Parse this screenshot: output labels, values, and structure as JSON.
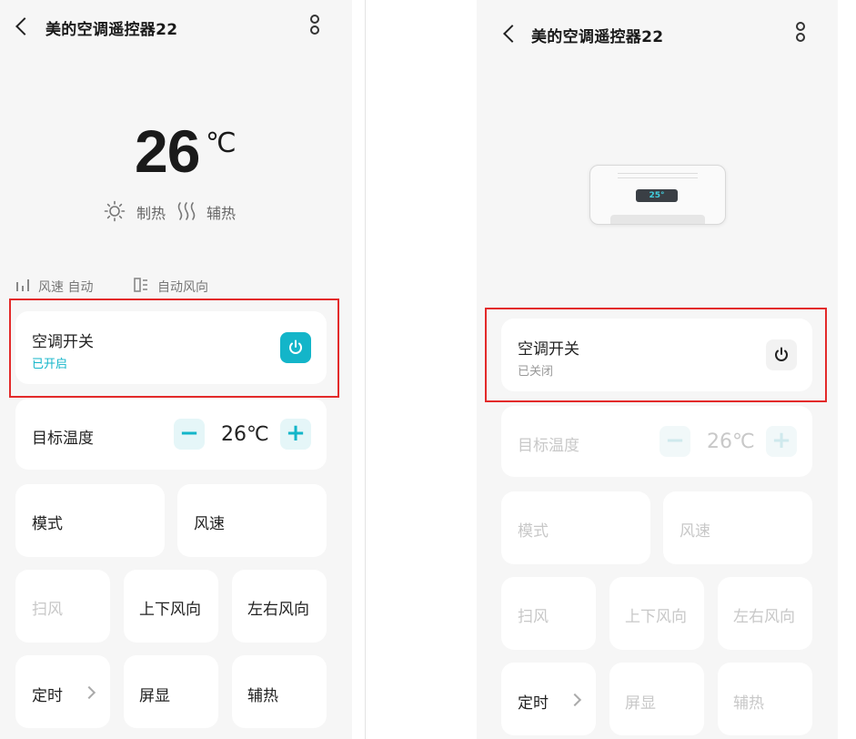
{
  "app_title": "美的空调遥控器22",
  "left": {
    "temperature": "26",
    "unit": "℃",
    "mode_label": "制热",
    "aux_heat_label": "辅热",
    "fan_speed_info": "风速 自动",
    "wind_direction_info": "自动风向",
    "power": {
      "label": "空调开关",
      "status": "已开启",
      "accent": "#13b5c9"
    },
    "target_temp": {
      "label": "目标温度",
      "minus": "−",
      "value": "26℃",
      "plus": "+"
    },
    "buttons": {
      "mode": "模式",
      "fan_speed": "风速",
      "swing": "扫风",
      "swing_vertical": "上下风向",
      "swing_horizontal": "左右风向",
      "timer": "定时",
      "display": "屏显",
      "aux_heat": "辅热"
    }
  },
  "right": {
    "ac_display": "25°",
    "power": {
      "label": "空调开关",
      "status": "已关闭"
    },
    "target_temp": {
      "label": "目标温度",
      "minus": "−",
      "value": "26℃",
      "plus": "+"
    },
    "buttons": {
      "mode": "模式",
      "fan_speed": "风速",
      "swing": "扫风",
      "swing_vertical": "上下风向",
      "swing_horizontal": "左右风向",
      "timer": "定时",
      "display": "屏显",
      "aux_heat": "辅热"
    }
  },
  "colors": {
    "accent": "#13b5c9",
    "highlight_box": "#e32a2a"
  }
}
